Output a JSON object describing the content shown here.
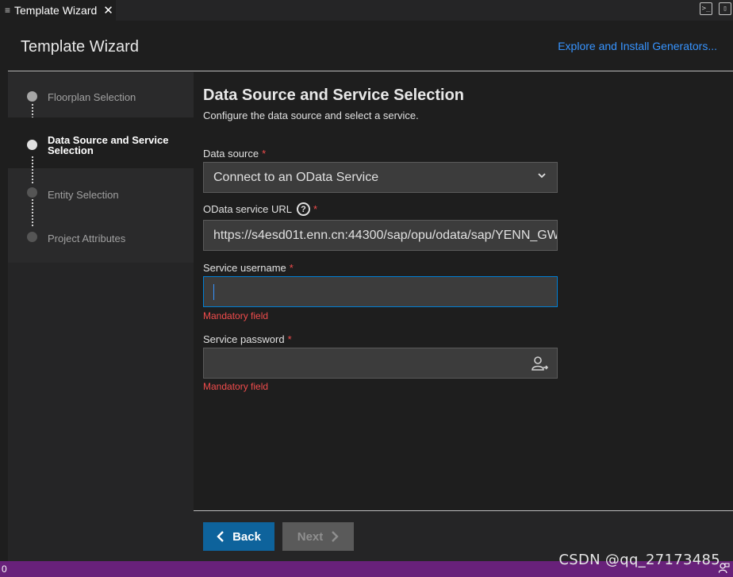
{
  "tab": {
    "title": "Template Wizard"
  },
  "header": {
    "title": "Template Wizard",
    "link": "Explore and Install Generators..."
  },
  "steps": [
    {
      "label": "Floorplan Selection",
      "state": "done"
    },
    {
      "label": "Data Source and Service Selection",
      "state": "active"
    },
    {
      "label": "Entity Selection",
      "state": "pending"
    },
    {
      "label": "Project Attributes",
      "state": "pending"
    }
  ],
  "main": {
    "title": "Data Source and Service Selection",
    "subtitle": "Configure the data source and select a service.",
    "data_source": {
      "label": "Data source",
      "required": "*",
      "value": "Connect to an OData Service"
    },
    "service_url": {
      "label": "OData service URL",
      "required": "*",
      "value": "https://s4esd01t.enn.cn:44300/sap/opu/odata/sap/YENN_GW"
    },
    "username": {
      "label": "Service username",
      "required": "*",
      "value": "",
      "error": "Mandatory field"
    },
    "password": {
      "label": "Service password",
      "required": "*",
      "value": "",
      "error": "Mandatory field"
    }
  },
  "footer": {
    "back_label": "Back",
    "next_label": "Next"
  },
  "statusbar": {
    "left": "0"
  },
  "watermark": "CSDN @qq_27173485",
  "colors": {
    "accent": "#3794ff",
    "primary_button": "#0e639c",
    "error": "#f14c4c",
    "statusbar": "#68217a"
  }
}
